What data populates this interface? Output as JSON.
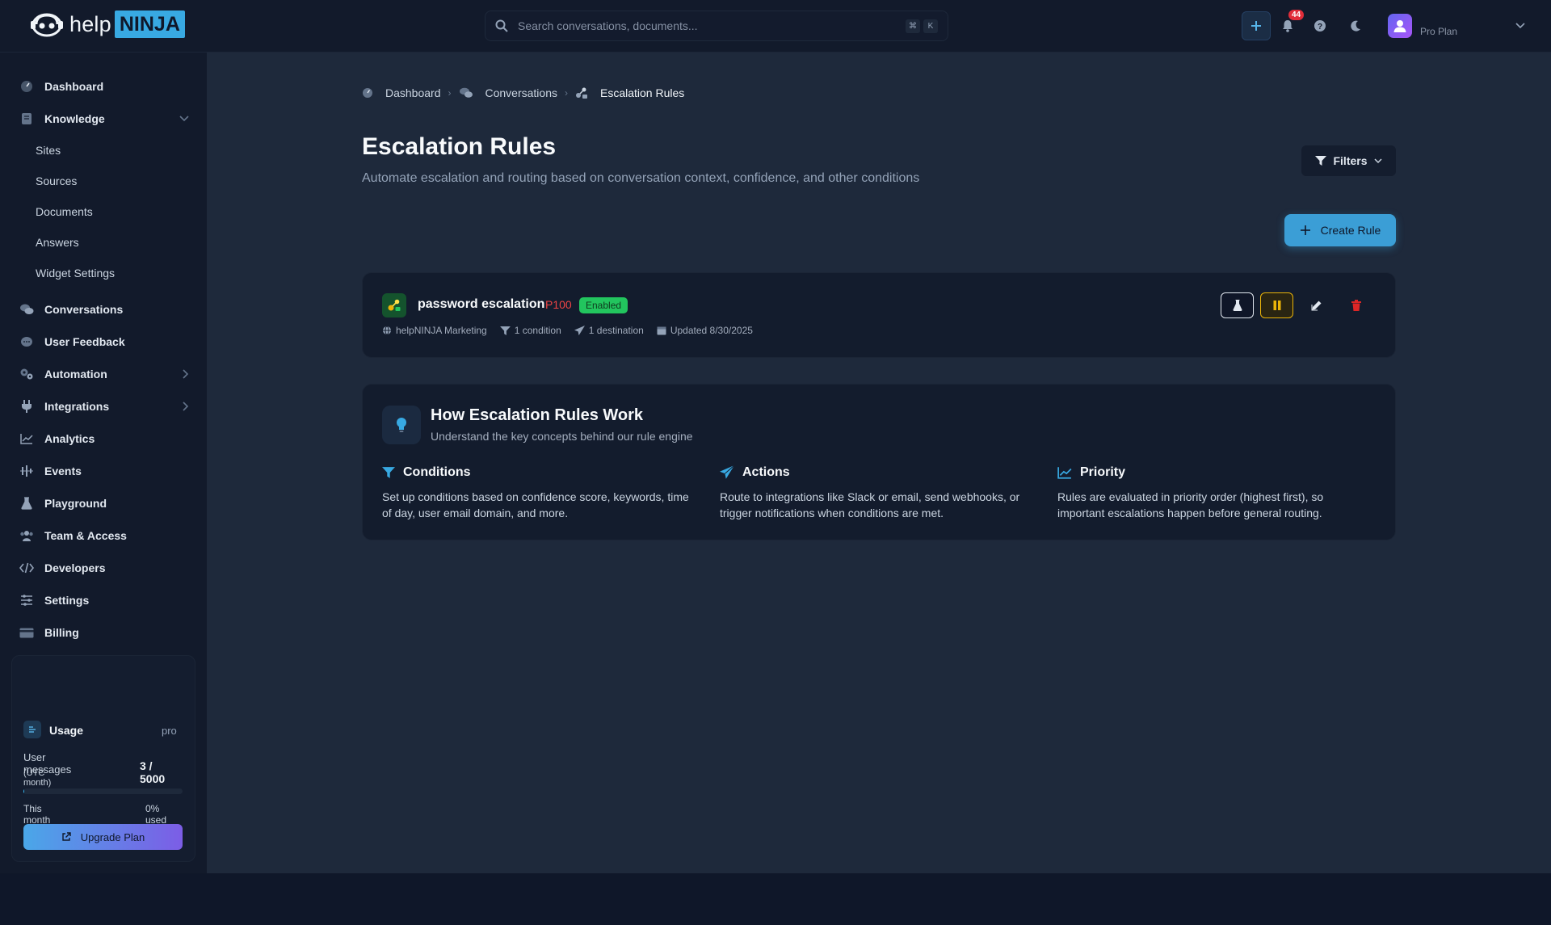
{
  "brand": {
    "part1": "help",
    "part2": "NINJA"
  },
  "header": {
    "search_placeholder": "Search conversations, documents...",
    "shortcut_keys": [
      "⌘",
      "K"
    ],
    "notification_count": "44",
    "plan_label": "Pro Plan"
  },
  "sidebar": {
    "items": [
      {
        "label": "Dashboard",
        "icon": "dashboard-icon"
      },
      {
        "label": "Knowledge",
        "icon": "book-icon"
      },
      {
        "label": "Conversations",
        "icon": "chat-icon"
      },
      {
        "label": "User Feedback",
        "icon": "feedback-icon"
      },
      {
        "label": "Automation",
        "icon": "gears-icon"
      },
      {
        "label": "Integrations",
        "icon": "plug-icon"
      },
      {
        "label": "Analytics",
        "icon": "chart-line-icon"
      },
      {
        "label": "Events",
        "icon": "events-icon"
      },
      {
        "label": "Playground",
        "icon": "flask-icon"
      },
      {
        "label": "Team & Access",
        "icon": "team-icon"
      },
      {
        "label": "Developers",
        "icon": "code-icon"
      },
      {
        "label": "Settings",
        "icon": "sliders-icon"
      },
      {
        "label": "Billing",
        "icon": "credit-card-icon"
      }
    ],
    "knowledge_sub": [
      "Sites",
      "Sources",
      "Documents",
      "Answers",
      "Widget Settings"
    ]
  },
  "usage": {
    "title": "Usage",
    "plan": "pro",
    "label_line1": "User messages",
    "label_line2": "(UTC month)",
    "count": "3 / 5000",
    "used_fraction": 0.0006,
    "period": "This month",
    "used_percent": "0% used",
    "upgrade_label": "Upgrade Plan"
  },
  "breadcrumb": {
    "items": [
      "Dashboard",
      "Conversations",
      "Escalation Rules"
    ]
  },
  "page": {
    "title": "Escalation Rules",
    "subtitle": "Automate escalation and routing based on conversation context, confidence, and other conditions",
    "filters_label": "Filters",
    "create_label": "Create Rule"
  },
  "rule": {
    "name": "password escalation",
    "priority": "P100",
    "status": "Enabled",
    "site": "helpNINJA Marketing",
    "conditions": "1 condition",
    "destinations": "1 destination",
    "updated": "Updated 8/30/2025"
  },
  "info": {
    "title": "How Escalation Rules Work",
    "subtitle": "Understand the key concepts behind our rule engine",
    "columns": [
      {
        "title": "Conditions",
        "text": "Set up conditions based on confidence score, keywords, time of day, user email domain, and more."
      },
      {
        "title": "Actions",
        "text": "Route to integrations like Slack or email, send webhooks, or trigger notifications when conditions are met."
      },
      {
        "title": "Priority",
        "text": "Rules are evaluated in priority order (highest first), so important escalations happen before general routing."
      }
    ]
  },
  "colors": {
    "accent": "#38a9e2",
    "enabled": "#22c55e",
    "priority": "#ef4444",
    "pause": "#eab308",
    "danger": "#dc2626"
  }
}
